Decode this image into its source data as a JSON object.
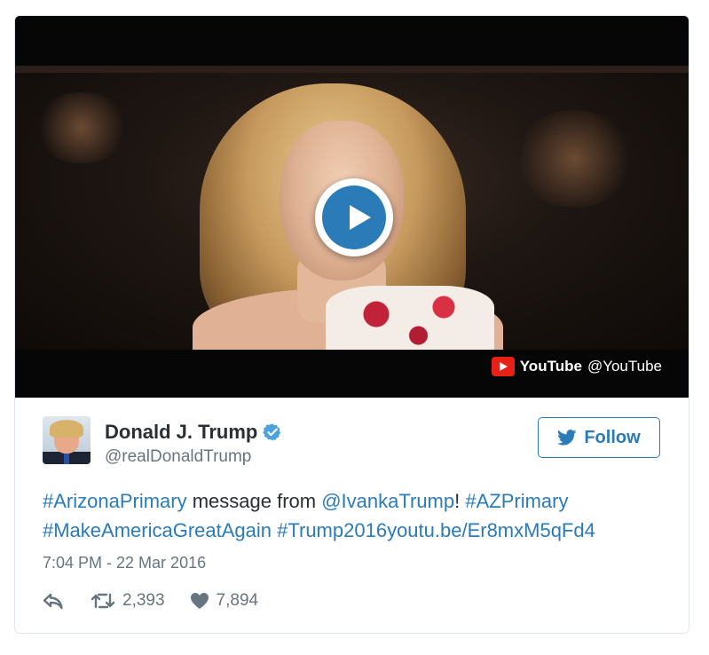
{
  "media": {
    "provider_name": "YouTube",
    "provider_handle": "@YouTube",
    "play_icon": "play-icon"
  },
  "tweet": {
    "author_name": "Donald J. Trump",
    "author_handle": "@realDonaldTrump",
    "follow_label": "Follow",
    "text_parts": {
      "tag1": "#ArizonaPrimary",
      "plain1": " message from ",
      "mention": "@IvankaTrump",
      "plain2": "! ",
      "tag2": "#AZPrimary",
      "tag3": "#MakeAmericaGreatAgain",
      "tag4": "#Trump2016",
      "link": "youtu.be/Er8mxM5qFd4"
    },
    "timestamp": "7:04 PM - 22 Mar 2016",
    "retweet_count": "2,393",
    "like_count": "7,894"
  },
  "colors": {
    "link": "#2b7bb9",
    "text": "#292f33",
    "muted": "#66757f",
    "youtube_red": "#e62117"
  }
}
